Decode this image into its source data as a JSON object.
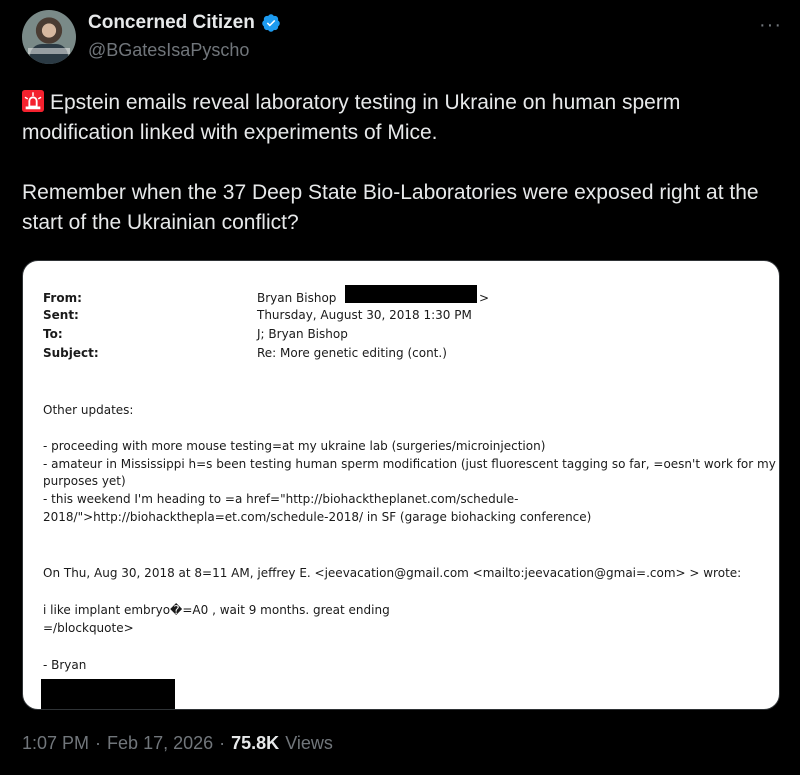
{
  "author": {
    "name": "Concerned Citizen",
    "handle": "@BGatesIsaPyscho"
  },
  "tweet": {
    "line1": "Epstein emails reveal laboratory testing in Ukraine on human sperm modification linked with experiments of Mice.",
    "line2": "Remember when the 37 Deep State Bio-Laboratories were exposed right at the start of the Ukrainian conflict?"
  },
  "email": {
    "from_label": "From:",
    "from_value": "Bryan Bishop",
    "from_tail": ">",
    "sent_label": "Sent:",
    "sent_value": "Thursday, August 30, 2018 1:30 PM",
    "to_label": "To:",
    "to_value": "J; Bryan Bishop",
    "subject_label": "Subject:",
    "subject_value": "Re: More genetic editing (cont.)",
    "body": [
      "Other updates:",
      "- proceeding with more mouse testing=at my ukraine lab (surgeries/microinjection)",
      "- amateur in Mississippi h=s been testing human sperm modification (just fluorescent tagging so far, =oesn't work for my",
      "purposes yet)",
      "- this weekend I'm heading to =a href=\"http://biohacktheplanet.com/schedule-",
      "2018/\">http://biohackthepla=et.com/schedule-2018/ in SF (garage biohacking conference)",
      "On Thu, Aug 30, 2018 at 8=11 AM, jeffrey E. <jeevacation@gmail.com <mailto:jeevacation@gmai=.com> > wrote:",
      "i like  implant embryo�=A0  , wait 9 months.    great ending",
      "=/blockquote>",
      "- Bryan"
    ]
  },
  "footer": {
    "time": "1:07 PM",
    "sep1": "·",
    "date": "Feb 17, 2026",
    "sep2": "·",
    "views_count": "75.8K",
    "views_label": "Views"
  },
  "icons": {
    "verified": "verified-badge-icon",
    "siren": "siren-icon",
    "more": "more-options-icon"
  },
  "colors": {
    "background": "#000000",
    "text": "#e7e9ea",
    "muted": "#71767b",
    "verified": "#1d9bf0",
    "siren": "#f4212e"
  }
}
